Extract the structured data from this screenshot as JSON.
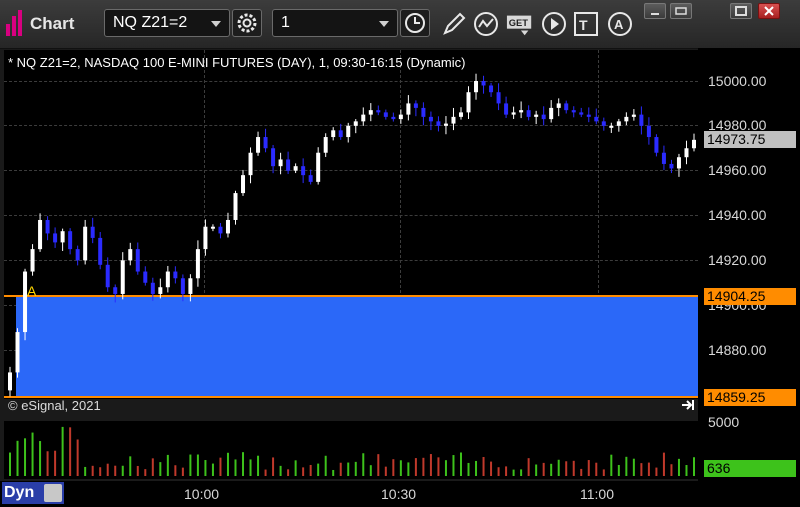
{
  "toolbar": {
    "app_title": "Chart",
    "symbol_value": "NQ Z21=2",
    "interval_value": "1",
    "icons": [
      "settings-gear-icon",
      "clock-icon",
      "draw-pencil-icon",
      "study-icon",
      "get-data-icon",
      "play-icon",
      "text-tool-icon",
      "alert-icon"
    ]
  },
  "window": {
    "buttons": [
      "restore-icon",
      "move-icon",
      "maximize-icon",
      "close-icon"
    ]
  },
  "chart": {
    "title": "* NQ Z21=2, NASDAQ 100 E-MINI FUTURES (DAY), 1, 09:30-16:15 (Dynamic)",
    "copyright": "© eSignal, 2021",
    "marker_label": "A",
    "last_price_label": "14973.75",
    "upper_line_label": "14904.25",
    "lower_line_label": "14859.25",
    "volume_axis_label": "5000",
    "volume_last_label": "636",
    "dyn_label": "Dyn",
    "colors": {
      "background": "#000000",
      "up_candle": "#ffffff",
      "down_candle": "#2b2bff",
      "rectangle": "#2b68f8",
      "line": "#ff8c00",
      "volume_badge": "#3dc21b",
      "last_badge": "#c0c0c0"
    }
  },
  "chart_data": {
    "type": "candlestick",
    "y_ticks": [
      "15000.00",
      "14980.00",
      "14960.00",
      "14940.00",
      "14920.00",
      "14900.00",
      "14880.00"
    ],
    "x_ticks": [
      "10:00",
      "10:30",
      "11:00"
    ],
    "ylim": [
      14859.25,
      15005
    ],
    "last_price": 14973.75,
    "rectangle": {
      "top": 14904.25,
      "bottom": 14859.25
    },
    "close_series": [
      14870,
      14888,
      14915,
      14925,
      14938,
      14932,
      14928,
      14933,
      14925,
      14920,
      14935,
      14930,
      14918,
      14908,
      14905,
      14920,
      14925,
      14915,
      14910,
      14905,
      14908,
      14915,
      14912,
      14905,
      14912,
      14925,
      14935,
      14935,
      14932,
      14938,
      14950,
      14958,
      14968,
      14975,
      14970,
      14962,
      14965,
      14960,
      14962,
      14958,
      14955,
      14968,
      14975,
      14978,
      14975,
      14980,
      14982,
      14985,
      14987,
      14986,
      14984,
      14983,
      14985,
      14990,
      14988,
      14984,
      14982,
      14980,
      14981,
      14984,
      14986,
      14995,
      15000,
      14998,
      14995,
      14990,
      14985,
      14986,
      14987,
      14984,
      14985,
      14983,
      14988,
      14990,
      14987,
      14986,
      14985,
      14984,
      14982,
      14980,
      14980,
      14982,
      14984,
      14985,
      14980,
      14975,
      14968,
      14963,
      14961,
      14966,
      14970,
      14973.75
    ],
    "volume_axis": "5000",
    "volume_last": 636
  }
}
